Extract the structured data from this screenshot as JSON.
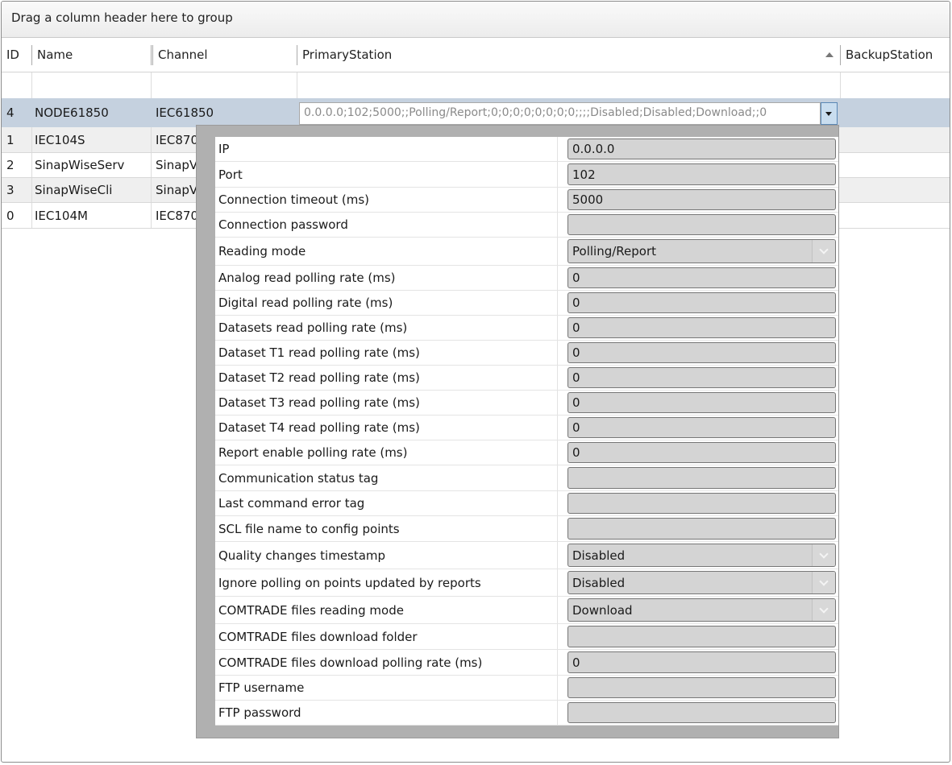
{
  "group_panel": {
    "text": "Drag a column header here to group"
  },
  "columns": [
    "ID",
    "Name",
    "Channel",
    "PrimaryStation",
    "BackupStation"
  ],
  "rows": [
    {
      "id": "4",
      "name": "NODE61850",
      "channel": "IEC61850",
      "primary": "0.0.0.0;102;5000;;Polling/Report;0;0;0;0;0;0;0;0;;;;Disabled;Disabled;Download;;0",
      "selected": true
    },
    {
      "id": "1",
      "name": "IEC104S",
      "channel": "IEC870"
    },
    {
      "id": "2",
      "name": "SinapWiseServ",
      "channel": "SinapV"
    },
    {
      "id": "3",
      "name": "SinapWiseCli",
      "channel": "SinapV"
    },
    {
      "id": "0",
      "name": "IEC104M",
      "channel": "IEC870"
    }
  ],
  "properties": [
    {
      "label": "IP",
      "value": "0.0.0.0"
    },
    {
      "label": "Port",
      "value": "102"
    },
    {
      "label": "Connection timeout (ms)",
      "value": "5000"
    },
    {
      "label": "Connection password",
      "value": ""
    },
    {
      "label": "Reading mode",
      "value": "Polling/Report",
      "combo": true
    },
    {
      "label": "Analog read polling rate (ms)",
      "value": "0"
    },
    {
      "label": "Digital read polling rate (ms)",
      "value": "0"
    },
    {
      "label": "Datasets read polling rate (ms)",
      "value": "0"
    },
    {
      "label": "Dataset T1 read polling rate (ms)",
      "value": "0"
    },
    {
      "label": "Dataset T2 read polling rate (ms)",
      "value": "0"
    },
    {
      "label": "Dataset T3 read polling rate (ms)",
      "value": "0"
    },
    {
      "label": "Dataset T4 read polling rate (ms)",
      "value": "0"
    },
    {
      "label": "Report enable polling rate (ms)",
      "value": "0"
    },
    {
      "label": "Communication status tag",
      "value": ""
    },
    {
      "label": "Last command error tag",
      "value": ""
    },
    {
      "label": "SCL file name to config points",
      "value": ""
    },
    {
      "label": "Quality changes timestamp",
      "value": "Disabled",
      "combo": true
    },
    {
      "label": "Ignore polling on points updated by reports",
      "value": "Disabled",
      "combo": true
    },
    {
      "label": "COMTRADE files reading mode",
      "value": "Download",
      "combo": true
    },
    {
      "label": "COMTRADE files download folder",
      "value": ""
    },
    {
      "label": "COMTRADE files download polling rate (ms)",
      "value": "0"
    },
    {
      "label": "FTP username",
      "value": ""
    },
    {
      "label": "FTP password",
      "value": ""
    }
  ],
  "colors": {
    "selected_row": "#c5d1df",
    "alt_row": "#efefef",
    "field_bg": "#d4d4d4",
    "popup_frame": "#b0b0b0"
  }
}
